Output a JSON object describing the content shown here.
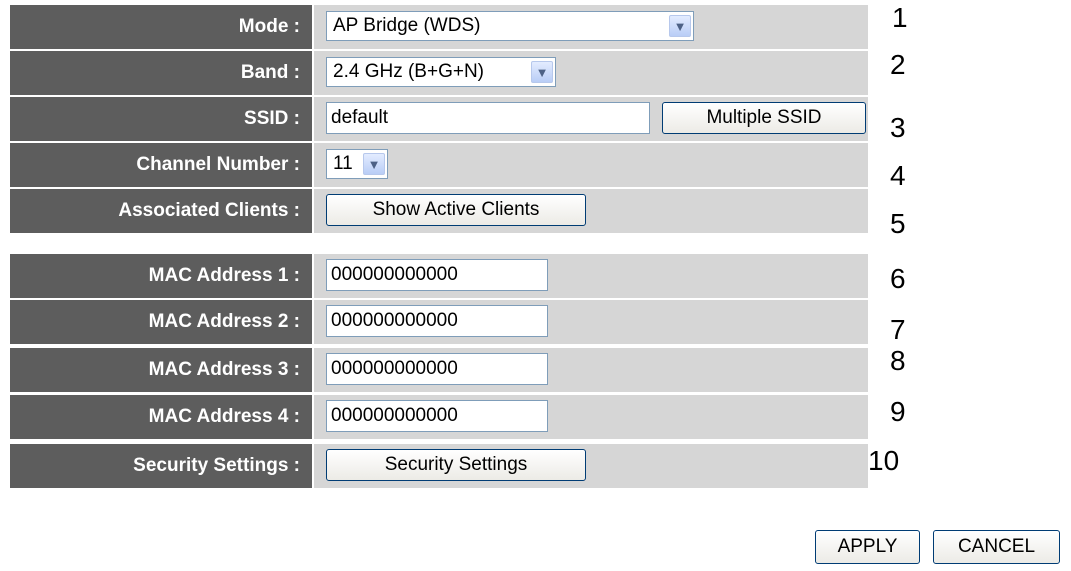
{
  "form": {
    "mode": {
      "label": "Mode :",
      "value": "AP Bridge (WDS)",
      "marker": "1"
    },
    "band": {
      "label": "Band :",
      "value": "2.4 GHz (B+G+N)",
      "marker": "2"
    },
    "ssid": {
      "label": "SSID :",
      "value": "default",
      "button": "Multiple SSID",
      "marker": "3"
    },
    "channel": {
      "label": "Channel Number :",
      "value": "11",
      "marker": "4"
    },
    "clients": {
      "label": "Associated Clients :",
      "button": "Show Active Clients",
      "marker": "5"
    },
    "mac1": {
      "label": "MAC Address 1 :",
      "value": "000000000000",
      "marker": "6"
    },
    "mac2": {
      "label": "MAC Address 2 :",
      "value": "000000000000",
      "marker": "7"
    },
    "mac3": {
      "label": "MAC Address 3 :",
      "value": "000000000000",
      "marker": "8"
    },
    "mac4": {
      "label": "MAC Address 4 :",
      "value": "000000000000",
      "marker": "9"
    },
    "security": {
      "label": "Security Settings :",
      "button": "Security Settings",
      "marker": "10"
    }
  },
  "footer": {
    "apply": "APPLY",
    "cancel": "CANCEL"
  },
  "icons": {
    "dropdown": "chevron-down-icon"
  },
  "colors": {
    "label_bg": "#5d5d5d",
    "value_bg": "#d6d6d6",
    "input_border": "#7f9db9",
    "button_border": "#003c74"
  }
}
